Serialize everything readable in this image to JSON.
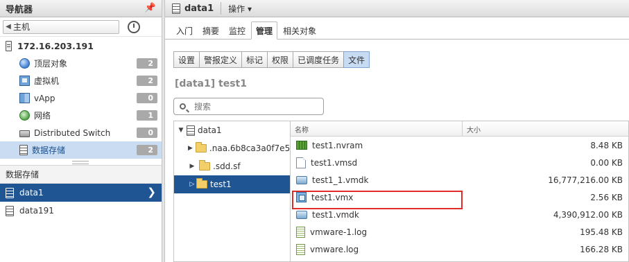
{
  "navigator": {
    "title": "导航器",
    "back_label": "主机",
    "host": "172.16.203.191",
    "items": [
      {
        "label": "顶层对象",
        "count": "2"
      },
      {
        "label": "虚拟机",
        "count": "2"
      },
      {
        "label": "vApp",
        "count": "0"
      },
      {
        "label": "网络",
        "count": "1"
      },
      {
        "label": "Distributed Switch",
        "count": "0"
      },
      {
        "label": "数据存储",
        "count": "2",
        "selected": true
      }
    ],
    "section_label": "数据存储",
    "datastores": [
      {
        "label": "data1",
        "selected": true
      },
      {
        "label": "data191"
      }
    ]
  },
  "main": {
    "title": "data1",
    "actions_label": "操作 ▾",
    "tabs": [
      "入门",
      "摘要",
      "监控",
      "管理",
      "相关对象"
    ],
    "active_tab": "管理",
    "subtabs": [
      "设置",
      "警报定义",
      "标记",
      "权限",
      "已调度任务",
      "文件"
    ],
    "active_subtab": "文件",
    "file_title": "[data1] test1",
    "search_placeholder": "搜索",
    "tree": [
      {
        "label": "data1"
      },
      {
        "label": ".naa.6b8ca3a0f7e5("
      },
      {
        "label": ".sdd.sf"
      },
      {
        "label": "test1"
      }
    ],
    "grid": {
      "col_name": "名称",
      "col_size": "大小",
      "rows": [
        {
          "name": "test1.nvram",
          "size": "8.48 KB",
          "icon": "nvram-icon"
        },
        {
          "name": "test1.vmsd",
          "size": "0.00 KB",
          "icon": "document-icon"
        },
        {
          "name": "test1_1.vmdk",
          "size": "16,777,216.00 KB",
          "icon": "disk-icon"
        },
        {
          "name": "test1.vmx",
          "size": "2.56 KB",
          "icon": "vm-config-icon"
        },
        {
          "name": "test1.vmdk",
          "size": "4,390,912.00 KB",
          "icon": "disk-icon"
        },
        {
          "name": "vmware-1.log",
          "size": "195.48 KB",
          "icon": "log-icon"
        },
        {
          "name": "vmware.log",
          "size": "166.28 KB",
          "icon": "log-icon"
        }
      ]
    }
  },
  "colors": {
    "selection": "#1f5592",
    "highlight_border": "#e02b2b",
    "nav_selected": "#c9dcf2"
  }
}
